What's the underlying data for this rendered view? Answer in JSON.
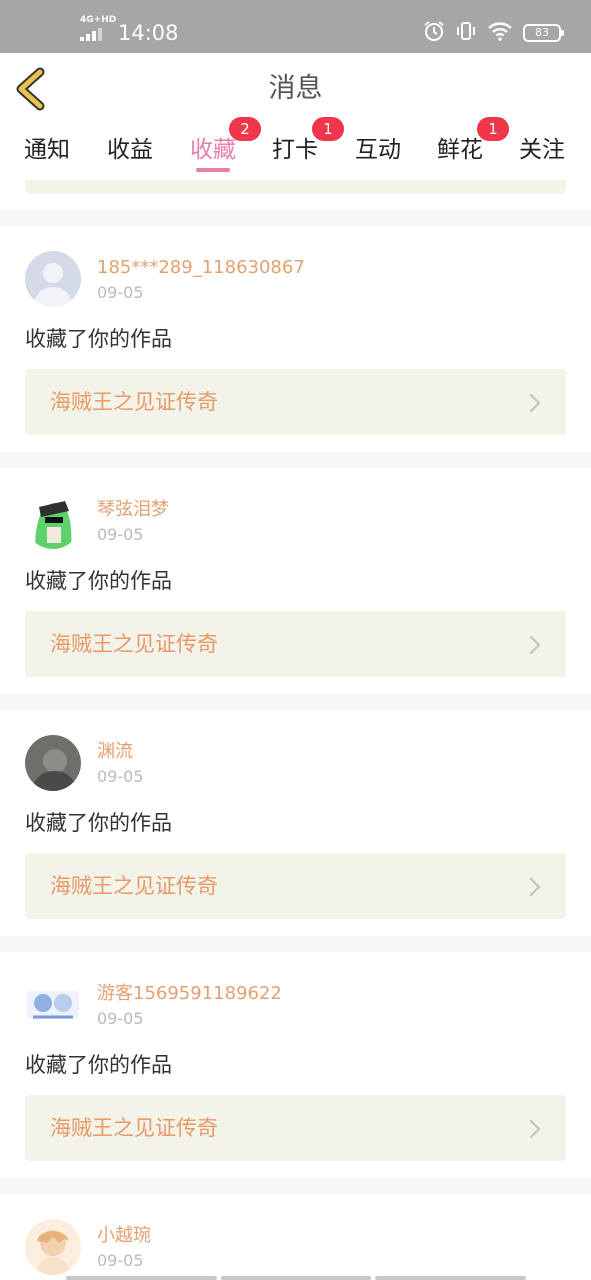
{
  "status_bar": {
    "network": "4G+HD",
    "time": "14:08",
    "battery": "83",
    "icons": [
      "alarm-icon",
      "vibrate-icon",
      "wifi-icon",
      "battery-icon"
    ]
  },
  "header": {
    "title": "消息",
    "back_icon": "chevron-left-icon"
  },
  "tabs": [
    {
      "label": "通知",
      "active": false
    },
    {
      "label": "收益",
      "active": false
    },
    {
      "label": "收藏",
      "active": true,
      "badge": "2"
    },
    {
      "label": "打卡",
      "active": false,
      "badge": "1"
    },
    {
      "label": "互动",
      "active": false
    },
    {
      "label": "鲜花",
      "active": false,
      "badge": "1"
    },
    {
      "label": "关注",
      "active": false
    }
  ],
  "cards": [
    {
      "user": "185***289_118630867",
      "date": "09-05",
      "action": "收藏了你的作品",
      "work": "海贼王之见证传奇"
    },
    {
      "user": "琴弦泪梦",
      "date": "09-05",
      "action": "收藏了你的作品",
      "work": "海贼王之见证传奇"
    },
    {
      "user": "渊流",
      "date": "09-05",
      "action": "收藏了你的作品",
      "work": "海贼王之见证传奇"
    },
    {
      "user": "游客1569591189622",
      "date": "09-05",
      "action": "收藏了你的作品",
      "work": "海贼王之见证传奇"
    },
    {
      "user": "小越琬",
      "date": "09-05"
    }
  ],
  "colors": {
    "accent_pink": "#e77fa7",
    "username_orange": "#e5a072",
    "link_bg": "#f4f3ea",
    "badge_red": "#f0364b",
    "back_arrow": "#e8c44c"
  }
}
